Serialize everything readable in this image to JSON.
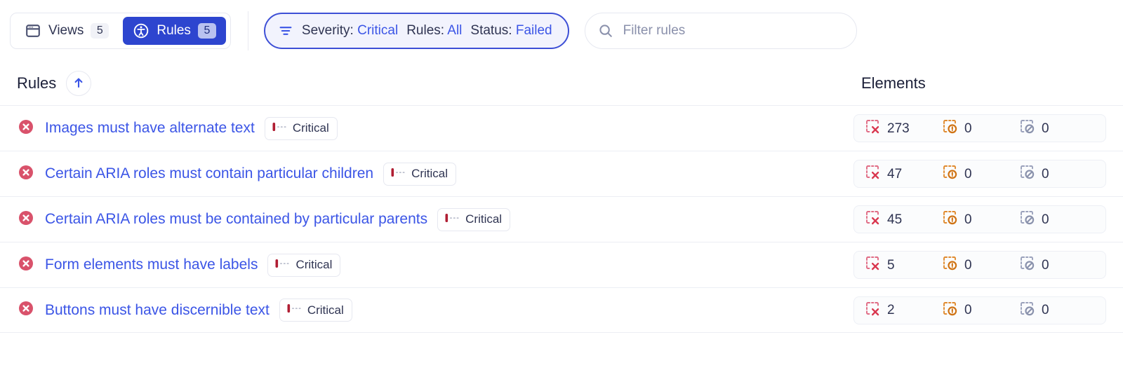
{
  "toolbar": {
    "views_tab": {
      "label": "Views",
      "count": "5",
      "icon": "browser-window-icon",
      "active": false
    },
    "rules_tab": {
      "label": "Rules",
      "count": "5",
      "icon": "accessibility-person-icon",
      "active": true
    },
    "filter_pill": {
      "icon": "filter-icon",
      "severity_label": "Severity:",
      "severity_value": "Critical",
      "rules_label": "Rules:",
      "rules_value": "All",
      "status_label": "Status:",
      "status_value": "Failed"
    },
    "search": {
      "icon": "search-icon",
      "placeholder": "Filter rules",
      "value": ""
    }
  },
  "table": {
    "headers": {
      "rules": "Rules",
      "elements": "Elements"
    },
    "sort": {
      "icon": "arrow-up-icon",
      "direction": "ascending"
    },
    "count_icons": {
      "violations": "dashed-box-x-icon",
      "incomplete": "dashed-box-exclamation-icon",
      "inapplicable": "dashed-box-slash-icon"
    },
    "rows": [
      {
        "status_icon": "error-circle-x-icon",
        "name": "Images must have alternate text",
        "severity": "Critical",
        "violations": "273",
        "incomplete": "0",
        "inapplicable": "0"
      },
      {
        "status_icon": "error-circle-x-icon",
        "name": "Certain ARIA roles must contain particular children",
        "severity": "Critical",
        "violations": "47",
        "incomplete": "0",
        "inapplicable": "0"
      },
      {
        "status_icon": "error-circle-x-icon",
        "name": "Certain ARIA roles must be contained by particular parents",
        "severity": "Critical",
        "violations": "45",
        "incomplete": "0",
        "inapplicable": "0"
      },
      {
        "status_icon": "error-circle-x-icon",
        "name": "Form elements must have labels",
        "severity": "Critical",
        "violations": "5",
        "incomplete": "0",
        "inapplicable": "0"
      },
      {
        "status_icon": "error-circle-x-icon",
        "name": "Buttons must have discernible text",
        "severity": "Critical",
        "violations": "2",
        "incomplete": "0",
        "inapplicable": "0"
      }
    ]
  },
  "colors": {
    "accent": "#3b55e6",
    "active_tab": "#2d45cf",
    "error": "#d9526b",
    "critical": "#b01e33",
    "warning": "#d97a15",
    "neutral": "#8a90ab"
  }
}
